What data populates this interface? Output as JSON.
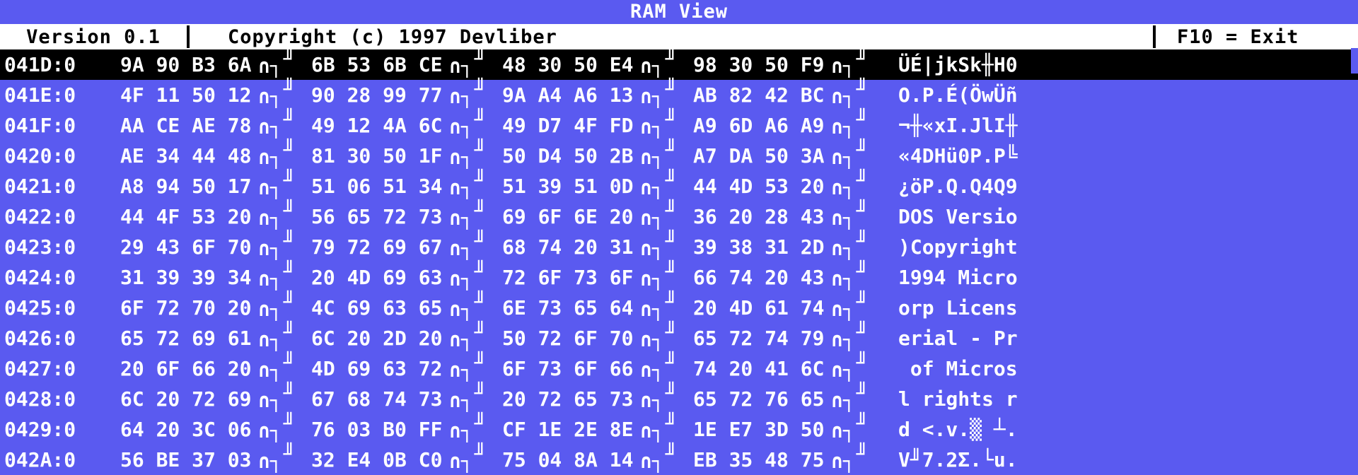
{
  "window": {
    "title": "RAM View",
    "colors": {
      "background": "#5a5af0",
      "title_text": "#ffffff",
      "infobar_bg": "#ffffff",
      "infobar_text": "#000000",
      "selected_row_bg": "#000000",
      "row_text": "#ffffff"
    }
  },
  "infobar": {
    "version": "Version 0.1",
    "copyright": "Copyright (c) 1997 Devliber",
    "exit_hint": "F10 = Exit"
  },
  "hexdump": {
    "group_separator_glyph_1": "∩┐",
    "group_separator_glyph_2": "╜",
    "rows": [
      {
        "address": "041D:0",
        "groups": [
          "9A 90 B3 6A",
          "6B 53 6B CE",
          "48 30 50 E4",
          "98 30 50 F9"
        ],
        "ascii": "ÜÉ|jkSk╫H0",
        "selected": true
      },
      {
        "address": "041E:0",
        "groups": [
          "4F 11 50 12",
          "90 28 99 77",
          "9A A4 A6 13",
          "AB 82 42 BC"
        ],
        "ascii": "O.P.É(ÖwÜñ",
        "selected": false
      },
      {
        "address": "041F:0",
        "groups": [
          "AA CE AE 78",
          "49 12 4A 6C",
          "49 D7 4F FD",
          "A9 6D A6 A9"
        ],
        "ascii": "¬╫«xI.JlI╫",
        "selected": false
      },
      {
        "address": "0420:0",
        "groups": [
          "AE 34 44 48",
          "81 30 50 1F",
          "50 D4 50 2B",
          "A7 DA 50 3A"
        ],
        "ascii": "«4DHü0P.P╚",
        "selected": false
      },
      {
        "address": "0421:0",
        "groups": [
          "A8 94 50 17",
          "51 06 51 34",
          "51 39 51 0D",
          "44 4D 53 20"
        ],
        "ascii": "¿öP.Q.Q4Q9",
        "selected": false
      },
      {
        "address": "0422:0",
        "groups": [
          "44 4F 53 20",
          "56 65 72 73",
          "69 6F 6E 20",
          "36 20 28 43"
        ],
        "ascii": "DOS Versio",
        "selected": false
      },
      {
        "address": "0423:0",
        "groups": [
          "29 43 6F 70",
          "79 72 69 67",
          "68 74 20 31",
          "39 38 31 2D"
        ],
        "ascii": ")Copyright",
        "selected": false
      },
      {
        "address": "0424:0",
        "groups": [
          "31 39 39 34",
          "20 4D 69 63",
          "72 6F 73 6F",
          "66 74 20 43"
        ],
        "ascii": "1994 Micro",
        "selected": false
      },
      {
        "address": "0425:0",
        "groups": [
          "6F 72 70 20",
          "4C 69 63 65",
          "6E 73 65 64",
          "20 4D 61 74"
        ],
        "ascii": "orp Licens",
        "selected": false
      },
      {
        "address": "0426:0",
        "groups": [
          "65 72 69 61",
          "6C 20 2D 20",
          "50 72 6F 70",
          "65 72 74 79"
        ],
        "ascii": "erial - Pr",
        "selected": false
      },
      {
        "address": "0427:0",
        "groups": [
          "20 6F 66 20",
          "4D 69 63 72",
          "6F 73 6F 66",
          "74 20 41 6C"
        ],
        "ascii": " of Micros",
        "selected": false
      },
      {
        "address": "0428:0",
        "groups": [
          "6C 20 72 69",
          "67 68 74 73",
          "20 72 65 73",
          "65 72 76 65"
        ],
        "ascii": "l rights r",
        "selected": false
      },
      {
        "address": "0429:0",
        "groups": [
          "64 20 3C 06",
          "76 03 B0 FF",
          "CF 1E 2E 8E",
          "1E E7 3D 50"
        ],
        "ascii": "d <.v.▒ ┴.",
        "selected": false
      },
      {
        "address": "042A:0",
        "groups": [
          "56 BE 37 03",
          "32 E4 0B C0",
          "75 04 8A 14",
          "EB 35 48 75"
        ],
        "ascii": "V╜7.2Σ.└u.",
        "selected": false
      }
    ]
  }
}
